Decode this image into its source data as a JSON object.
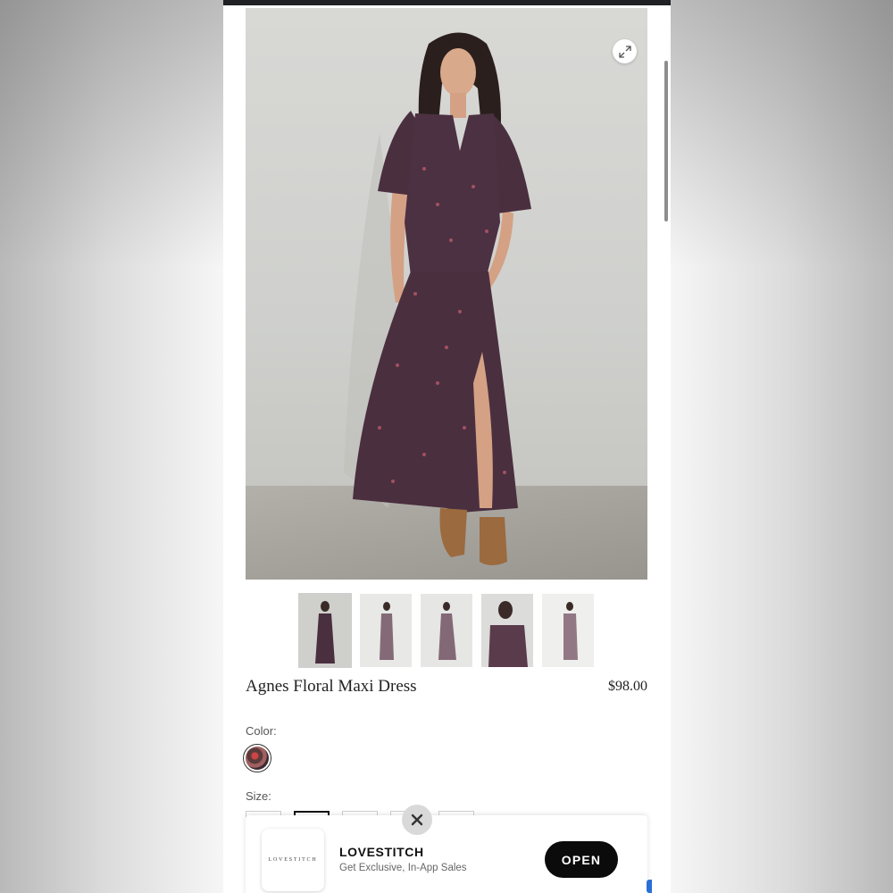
{
  "product": {
    "title": "Agnes Floral Maxi Dress",
    "price": "$98.00",
    "color_label": "Color:",
    "size_label": "Size:",
    "thumbnail_count": 5,
    "selected_thumbnail": 1,
    "selected_size": 2
  },
  "app_banner": {
    "logo_text": "LOVESTITCH",
    "app_name": "LOVESTITCH",
    "subtitle": "Get Exclusive, In-App Sales",
    "open_label": "OPEN"
  },
  "icons": {
    "expand": "expand-icon",
    "close": "close-icon"
  },
  "colors": {
    "dress": "#4a2f3f",
    "boots": "#9b6a3e",
    "button": "#0b0b0b"
  }
}
